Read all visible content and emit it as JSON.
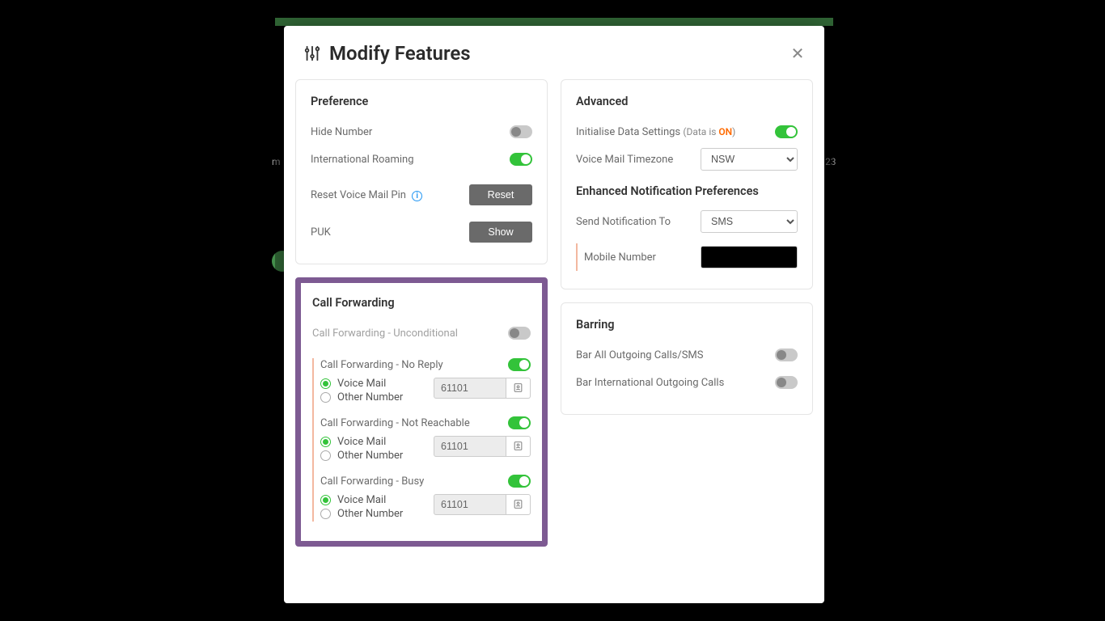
{
  "modal": {
    "title": "Modify Features"
  },
  "preference": {
    "heading": "Preference",
    "hide_number_label": "Hide Number",
    "hide_number_on": false,
    "intl_roaming_label": "International Roaming",
    "intl_roaming_on": true,
    "reset_voicemail_label": "Reset Voice Mail Pin",
    "reset_btn": "Reset",
    "puk_label": "PUK",
    "show_btn": "Show"
  },
  "advanced": {
    "heading": "Advanced",
    "init_data_label": "Initialise Data Settings",
    "data_note_prefix": "(Data is ",
    "data_note_state": "ON",
    "data_note_suffix": ")",
    "init_data_on": true,
    "voicemail_tz_label": "Voice Mail Timezone",
    "voicemail_tz_value": "NSW",
    "enp_heading": "Enhanced Notification Preferences",
    "send_to_label": "Send Notification To",
    "send_to_value": "SMS",
    "mobile_number_label": "Mobile Number",
    "mobile_number_value": ""
  },
  "call_forwarding": {
    "heading": "Call Forwarding",
    "unconditional_label": "Call Forwarding - Unconditional",
    "unconditional_on": false,
    "voice_mail_label": "Voice Mail",
    "other_number_label": "Other Number",
    "sections": [
      {
        "title": "Call Forwarding - No Reply",
        "on": true,
        "voicemail": true,
        "number": "61101"
      },
      {
        "title": "Call Forwarding - Not Reachable",
        "on": true,
        "voicemail": true,
        "number": "61101"
      },
      {
        "title": "Call Forwarding - Busy",
        "on": true,
        "voicemail": true,
        "number": "61101"
      }
    ]
  },
  "barring": {
    "heading": "Barring",
    "bar_all_label": "Bar All Outgoing Calls/SMS",
    "bar_all_on": false,
    "bar_intl_label": "Bar International Outgoing Calls",
    "bar_intl_on": false
  },
  "bg": {
    "left_text": "m",
    "right_text": "23"
  }
}
